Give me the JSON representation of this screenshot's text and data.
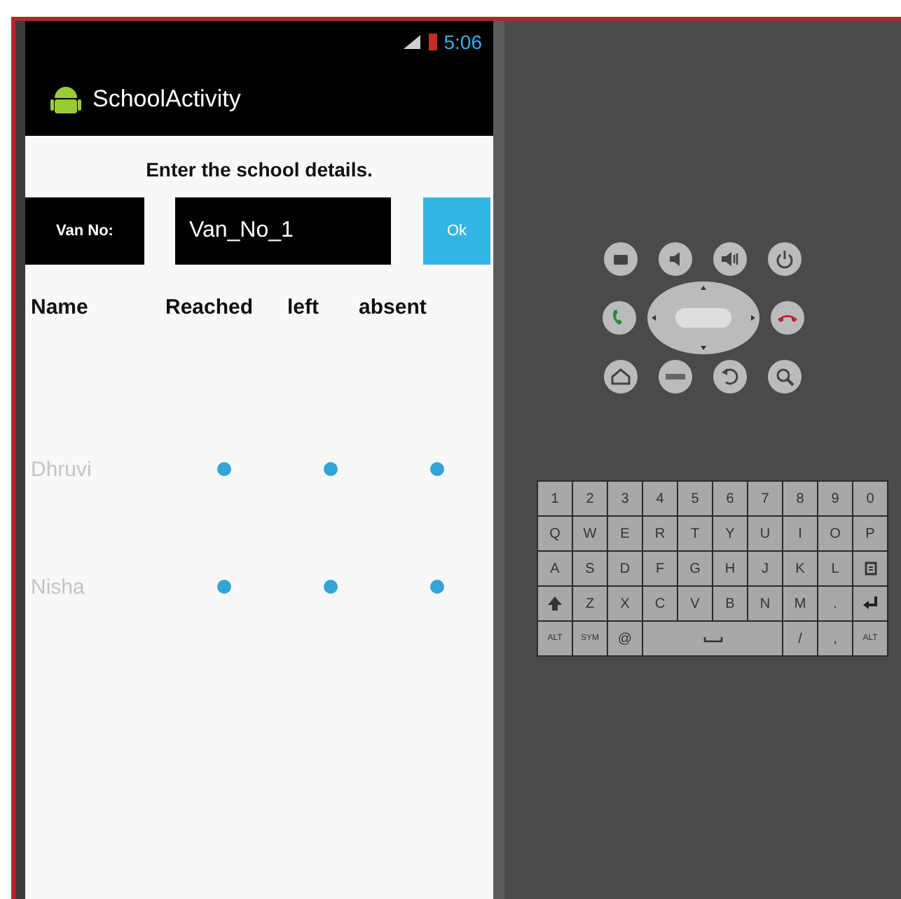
{
  "status_bar": {
    "time": "5:06"
  },
  "action_bar": {
    "title": "SchoolActivity"
  },
  "heading": "Enter the school details.",
  "van": {
    "label": "Van No:",
    "value": "Van_No_1",
    "button": "Ok"
  },
  "columns": [
    "Name",
    "Reached",
    "left",
    "absent"
  ],
  "rows": [
    {
      "name": "Dhruvi",
      "options": [
        {
          "checked": true
        },
        {
          "checked": true
        },
        {
          "checked": true
        }
      ]
    },
    {
      "name": "Nisha",
      "options": [
        {
          "checked": true
        },
        {
          "checked": true
        },
        {
          "checked": true
        }
      ]
    }
  ],
  "keyboard": {
    "rows": [
      [
        {
          "kind": "char",
          "label": "1"
        },
        {
          "kind": "char",
          "label": "2"
        },
        {
          "kind": "char",
          "label": "3"
        },
        {
          "kind": "char",
          "label": "4"
        },
        {
          "kind": "char",
          "label": "5"
        },
        {
          "kind": "char",
          "label": "6"
        },
        {
          "kind": "char",
          "label": "7"
        },
        {
          "kind": "char",
          "label": "8"
        },
        {
          "kind": "char",
          "label": "9"
        },
        {
          "kind": "char",
          "label": "0"
        }
      ],
      [
        {
          "kind": "char",
          "label": "Q"
        },
        {
          "kind": "char",
          "label": "W"
        },
        {
          "kind": "char",
          "label": "E"
        },
        {
          "kind": "char",
          "label": "R"
        },
        {
          "kind": "char",
          "label": "T"
        },
        {
          "kind": "char",
          "label": "Y"
        },
        {
          "kind": "char",
          "label": "U"
        },
        {
          "kind": "char",
          "label": "I"
        },
        {
          "kind": "char",
          "label": "O"
        },
        {
          "kind": "char",
          "label": "P"
        }
      ],
      [
        {
          "kind": "char",
          "label": "A"
        },
        {
          "kind": "char",
          "label": "S"
        },
        {
          "kind": "char",
          "label": "D"
        },
        {
          "kind": "char",
          "label": "F"
        },
        {
          "kind": "char",
          "label": "G"
        },
        {
          "kind": "char",
          "label": "H"
        },
        {
          "kind": "char",
          "label": "J"
        },
        {
          "kind": "char",
          "label": "K"
        },
        {
          "kind": "char",
          "label": "L"
        },
        {
          "kind": "delete"
        }
      ],
      [
        {
          "kind": "shift"
        },
        {
          "kind": "char",
          "label": "Z"
        },
        {
          "kind": "char",
          "label": "X"
        },
        {
          "kind": "char",
          "label": "C"
        },
        {
          "kind": "char",
          "label": "V"
        },
        {
          "kind": "char",
          "label": "B"
        },
        {
          "kind": "char",
          "label": "N"
        },
        {
          "kind": "char",
          "label": "M"
        },
        {
          "kind": "char",
          "label": "."
        },
        {
          "kind": "enter"
        }
      ]
    ],
    "bottom_row": [
      {
        "kind": "small",
        "label": "ALT"
      },
      {
        "kind": "small",
        "label": "SYM"
      },
      {
        "kind": "char",
        "label": "@"
      },
      {
        "kind": "space"
      },
      {
        "kind": "char",
        "label": "/"
      },
      {
        "kind": "char",
        "label": ","
      },
      {
        "kind": "small",
        "label": "ALT"
      }
    ]
  }
}
